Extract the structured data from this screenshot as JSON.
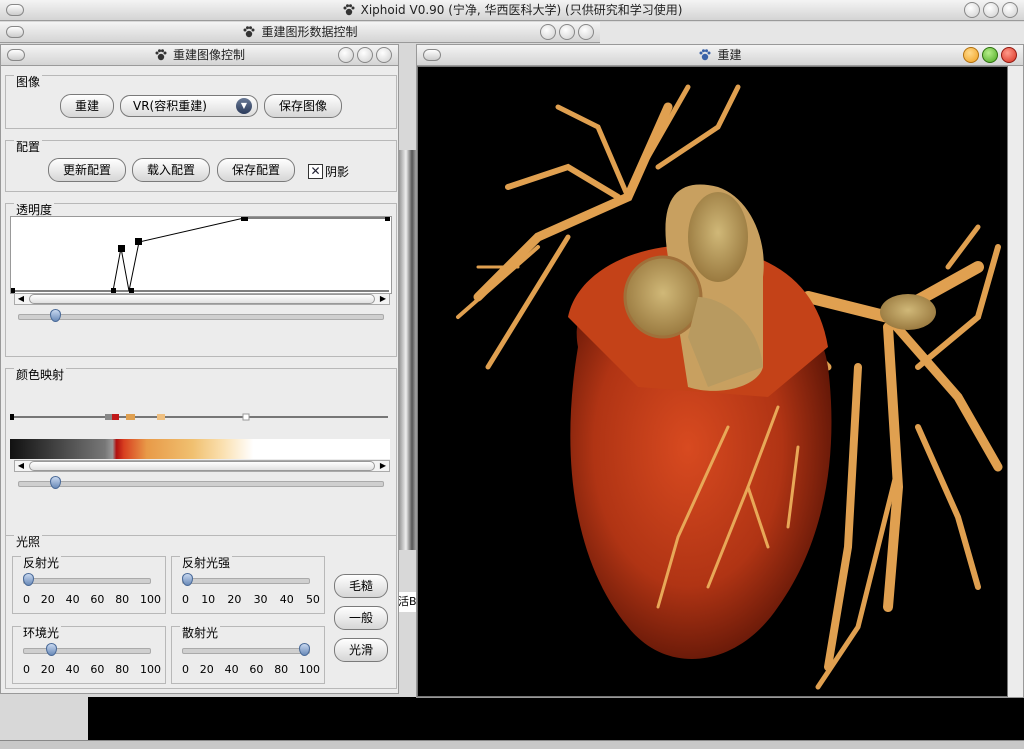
{
  "main_window": {
    "title": "Xiphoid V0.90 (宁净, 华西医科大学) (只供研究和学习使用)"
  },
  "data_window": {
    "title": "重建图形数据控制"
  },
  "control_window": {
    "title": "重建图像控制"
  },
  "render_window": {
    "title": "重建"
  },
  "image_group": {
    "label": "图像",
    "reconstruct_button": "重建",
    "mode_select": "VR(容积重建)",
    "save_image_button": "保存图像"
  },
  "config_group": {
    "label": "配置",
    "update_button": "更新配置",
    "load_button": "载入配置",
    "save_button": "保存配置",
    "shadow_label": "阴影",
    "shadow_checked": true
  },
  "opacity_group": {
    "label": "透明度",
    "slider_level": 0.09
  },
  "colormap_group": {
    "label": "颜色映射",
    "slider_level": 0.09,
    "stop_colors": [
      "#000000",
      "#888888",
      "#c01818",
      "#e0a050",
      "#f0c080",
      "#ffffff"
    ]
  },
  "lighting_group": {
    "label": "光照",
    "reflect": {
      "label": "反射光",
      "ticks": [
        "0",
        "20",
        "40",
        "60",
        "80",
        "100"
      ],
      "value": 0
    },
    "reflect_strength": {
      "label": "反射光强",
      "ticks": [
        "0",
        "10",
        "20",
        "30",
        "40",
        "50"
      ],
      "value": 0
    },
    "ambient": {
      "label": "环境光",
      "ticks": [
        "0",
        "20",
        "40",
        "60",
        "80",
        "100"
      ],
      "value": 20
    },
    "diffuse": {
      "label": "散射光",
      "ticks": [
        "0",
        "20",
        "40",
        "60",
        "80",
        "100"
      ],
      "value": 100
    },
    "rough_button": "毛糙",
    "normal_button": "一般",
    "smooth_button": "光滑"
  },
  "background_partial_text": "活B",
  "colors": {
    "heart_muscle": "#b83a18",
    "vessels": "#e8a050",
    "aorta_cut": "#c8b070",
    "background": "#000000"
  }
}
